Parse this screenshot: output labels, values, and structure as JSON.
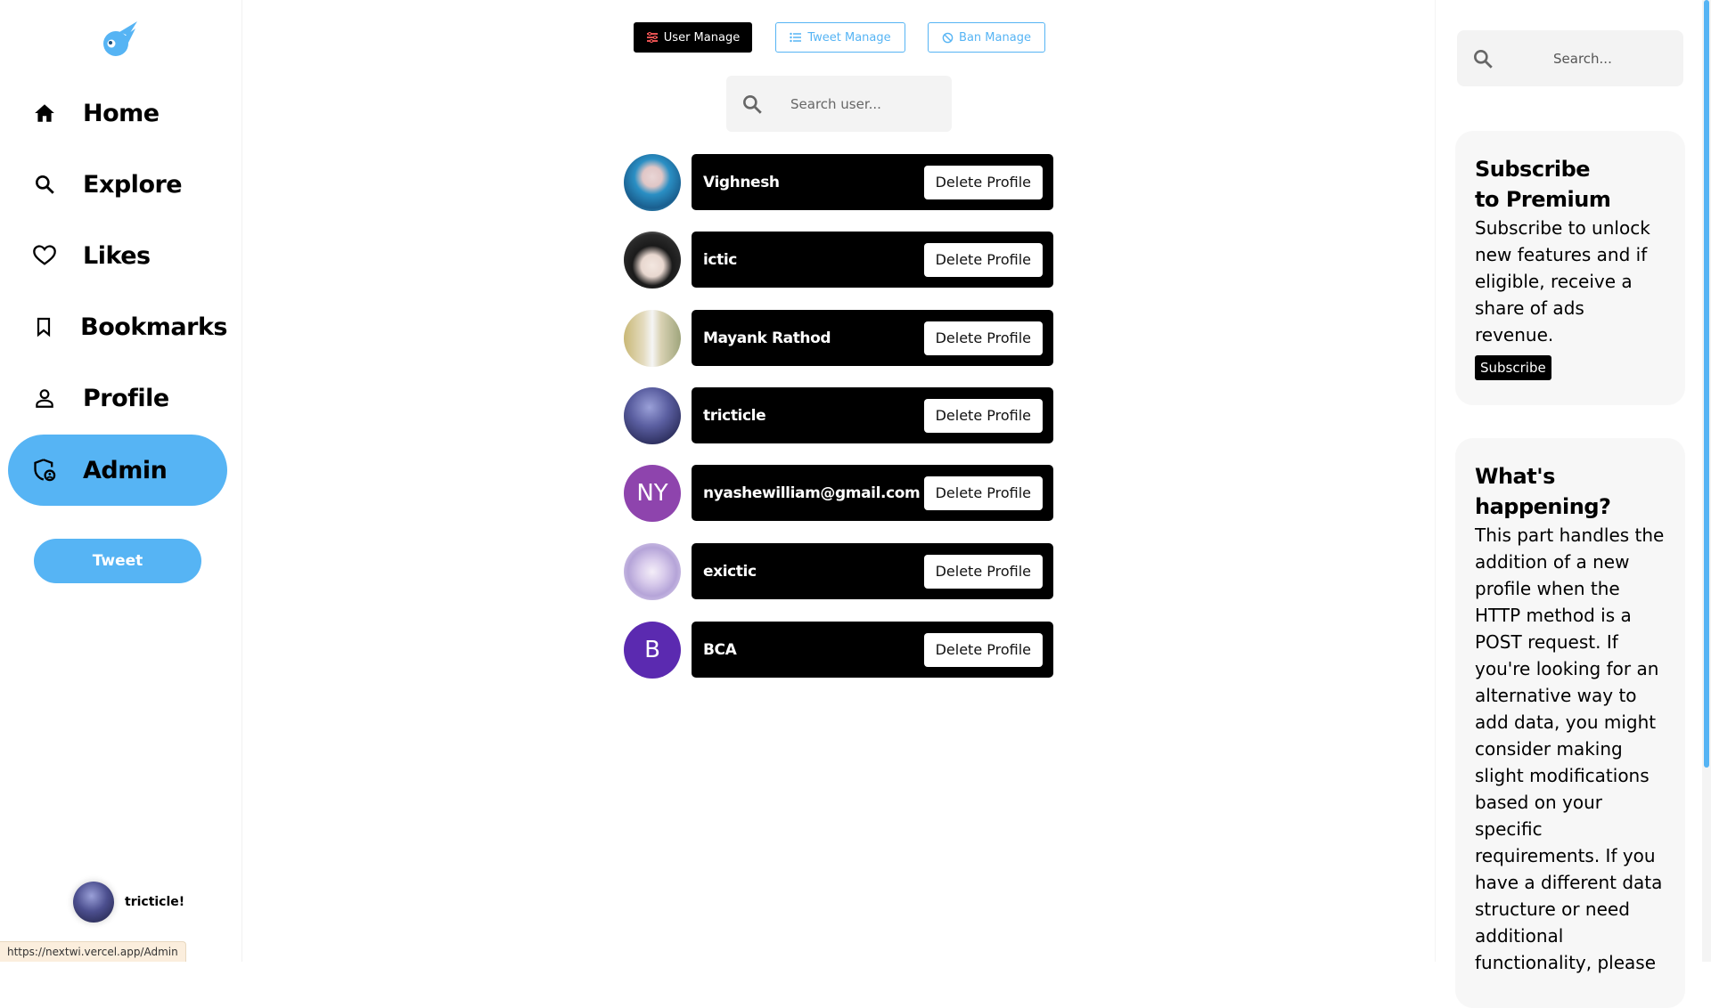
{
  "sidebar": {
    "nav": [
      {
        "label": "Home",
        "icon": "home-icon"
      },
      {
        "label": "Explore",
        "icon": "search-icon"
      },
      {
        "label": "Likes",
        "icon": "heart-icon"
      },
      {
        "label": "Bookmarks",
        "icon": "bookmark-icon"
      },
      {
        "label": "Profile",
        "icon": "person-icon"
      },
      {
        "label": "Admin",
        "icon": "admin-shield-icon",
        "active": true
      }
    ],
    "tweet_label": "Tweet",
    "current_user": "tricticle!"
  },
  "status_url": "https://nextwi.vercel.app/Admin",
  "main": {
    "tabs": [
      {
        "label": "User Manage",
        "icon": "sliders-icon",
        "active": true
      },
      {
        "label": "Tweet Manage",
        "icon": "list-icon"
      },
      {
        "label": "Ban Manage",
        "icon": "ban-icon"
      }
    ],
    "search_placeholder": "Search user...",
    "delete_label": "Delete Profile",
    "users": [
      {
        "name": "Vighnesh",
        "avatar": "image"
      },
      {
        "name": "ictic",
        "avatar": "image"
      },
      {
        "name": "Mayank Rathod",
        "avatar": "image"
      },
      {
        "name": "tricticle",
        "avatar": "image"
      },
      {
        "name": "nyashewilliam@gmail.com",
        "avatar": "initials",
        "initials": "NY"
      },
      {
        "name": "exictic",
        "avatar": "image"
      },
      {
        "name": "BCA",
        "avatar": "initials",
        "initials": "B"
      }
    ]
  },
  "right": {
    "search_placeholder": "Search...",
    "premium": {
      "title_line1": "Subscribe",
      "title_line2": "to Premium",
      "body": "Subscribe to unlock new features and if eligible, receive a share of ads revenue.",
      "button": "Subscribe"
    },
    "happening": {
      "title_line1": "What's",
      "title_line2": "happening?",
      "body": "This part handles the addition of a new profile when the HTTP method is a POST request. If you're looking for an alternative way to add data, you might consider making slight modifications based on your specific requirements. If you have a different data structure or need additional functionality, please"
    }
  },
  "colors": {
    "accent": "#56b4f4",
    "bar": "#000000",
    "ny_avatar": "#8e44ad",
    "b_avatar": "#5b2ab0"
  }
}
